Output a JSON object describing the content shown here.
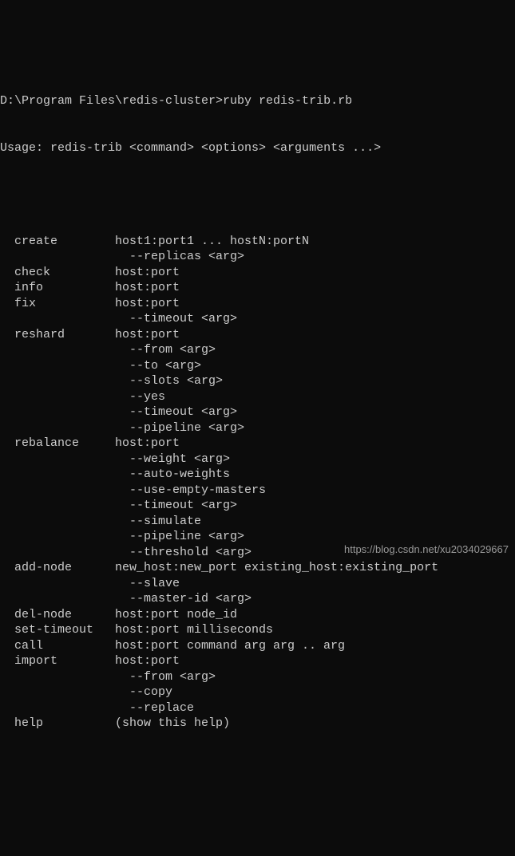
{
  "prompt": "D:\\Program Files\\redis-cluster>ruby redis-trib.rb",
  "usage": "Usage: redis-trib <command> <options> <arguments ...>",
  "commands": [
    {
      "name": "create",
      "desc": "host1:port1 ... hostN:portN",
      "options": [
        "--replicas <arg>"
      ]
    },
    {
      "name": "check",
      "desc": "host:port",
      "options": []
    },
    {
      "name": "info",
      "desc": "host:port",
      "options": []
    },
    {
      "name": "fix",
      "desc": "host:port",
      "options": [
        "--timeout <arg>"
      ]
    },
    {
      "name": "reshard",
      "desc": "host:port",
      "options": [
        "--from <arg>",
        "--to <arg>",
        "--slots <arg>",
        "--yes",
        "--timeout <arg>",
        "--pipeline <arg>"
      ]
    },
    {
      "name": "rebalance",
      "desc": "host:port",
      "options": [
        "--weight <arg>",
        "--auto-weights",
        "--use-empty-masters",
        "--timeout <arg>",
        "--simulate",
        "--pipeline <arg>",
        "--threshold <arg>"
      ]
    },
    {
      "name": "add-node",
      "desc": "new_host:new_port existing_host:existing_port",
      "options": [
        "--slave",
        "--master-id <arg>"
      ]
    },
    {
      "name": "del-node",
      "desc": "host:port node_id",
      "options": []
    },
    {
      "name": "set-timeout",
      "desc": "host:port milliseconds",
      "options": []
    },
    {
      "name": "call",
      "desc": "host:port command arg arg .. arg",
      "options": []
    },
    {
      "name": "import",
      "desc": "host:port",
      "options": [
        "--from <arg>",
        "--copy",
        "--replace"
      ]
    },
    {
      "name": "help",
      "desc": "(show this help)",
      "options": []
    }
  ],
  "watermark": "https://blog.csdn.net/xu2034029667"
}
